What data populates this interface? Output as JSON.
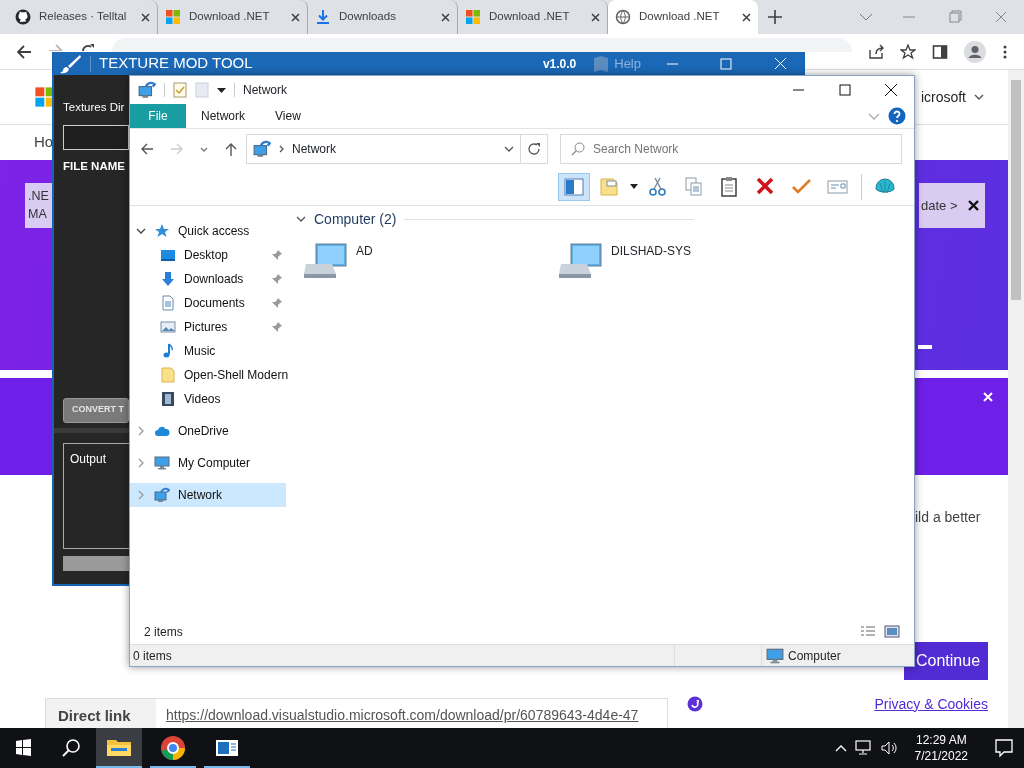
{
  "browser": {
    "tabs": [
      {
        "title": "Releases · Telltal",
        "kind": "github",
        "selected": false
      },
      {
        "title": "Download .NET",
        "kind": "microsoft",
        "selected": false
      },
      {
        "title": "Downloads",
        "kind": "download",
        "selected": false
      },
      {
        "title": "Download .NET",
        "kind": "microsoft",
        "selected": false
      },
      {
        "title": "Download .NET",
        "kind": "globe",
        "selected": true
      }
    ],
    "page": {
      "account_menu": "icrosoft",
      "nav_text": "Ho",
      "notice_lines": [
        ".NE",
        "MA"
      ],
      "notice_link": "date >",
      "partial_text": "ild a better",
      "continue_button": "Continue",
      "privacy_link": "Privacy & Cookies",
      "direct_link": {
        "label": "Direct link",
        "url": "https://download.visualstudio.microsoft.com/download/pr/60789643-4d4e-47"
      }
    }
  },
  "texture_tool": {
    "title": "TEXTURE MOD TOOL",
    "version": "v1.0.0",
    "help": "Help",
    "dir_label": "Textures Dir",
    "file_name_header": "FILE NAME",
    "convert_button": {
      "label": "CONVERT T",
      "disabled": true
    },
    "output_label": "Output"
  },
  "explorer": {
    "title": "Network",
    "ribbon_tabs": [
      {
        "label": "File",
        "selected": true
      },
      {
        "label": "Network",
        "selected": false
      },
      {
        "label": "View",
        "selected": false
      }
    ],
    "address": "Network",
    "search": {
      "placeholder": "Search Network"
    },
    "toolbar": [
      {
        "kind": "pane",
        "on": true
      },
      {
        "kind": "folder-options",
        "on": false
      },
      {
        "kind": "cut",
        "on": false
      },
      {
        "kind": "copy",
        "on": false
      },
      {
        "kind": "paste",
        "on": false
      },
      {
        "kind": "delete",
        "on": false
      },
      {
        "kind": "check",
        "on": false
      },
      {
        "kind": "email",
        "on": false
      },
      {
        "kind": "shell",
        "on": false
      }
    ],
    "nav_tree": [
      {
        "label": "Quick access",
        "kind": "star",
        "expanded": true,
        "selected": false,
        "children": [
          {
            "label": "Desktop",
            "kind": "desktop",
            "pinned": true,
            "selected": false
          },
          {
            "label": "Downloads",
            "kind": "download",
            "pinned": true,
            "selected": false
          },
          {
            "label": "Documents",
            "kind": "document",
            "pinned": true,
            "selected": false
          },
          {
            "label": "Pictures",
            "kind": "picture",
            "pinned": true,
            "selected": false
          },
          {
            "label": "Music",
            "kind": "music",
            "pinned": false,
            "selected": false
          },
          {
            "label": "Open-Shell Modern",
            "kind": "folder",
            "pinned": false,
            "selected": false
          },
          {
            "label": "Videos",
            "kind": "video",
            "pinned": false,
            "selected": false
          }
        ]
      },
      {
        "label": "OneDrive",
        "kind": "cloud",
        "expanded": false,
        "selected": false
      },
      {
        "label": "My Computer",
        "kind": "computer",
        "expanded": false,
        "selected": false
      },
      {
        "label": "Network",
        "kind": "network",
        "expanded": false,
        "selected": true
      }
    ],
    "group": {
      "title": "Computer (2)",
      "items": [
        {
          "label": "AD"
        },
        {
          "label": "DILSHAD-SYS"
        }
      ]
    },
    "item_count": "2 items",
    "status_bar": {
      "selection": "0 items",
      "zone": "Computer"
    }
  },
  "taskbar": {
    "apps": [
      {
        "kind": "explorer",
        "active": true
      },
      {
        "kind": "chrome",
        "active": false
      },
      {
        "kind": "app",
        "active": false
      }
    ],
    "time": "12:29 AM",
    "date": "7/21/2022"
  }
}
